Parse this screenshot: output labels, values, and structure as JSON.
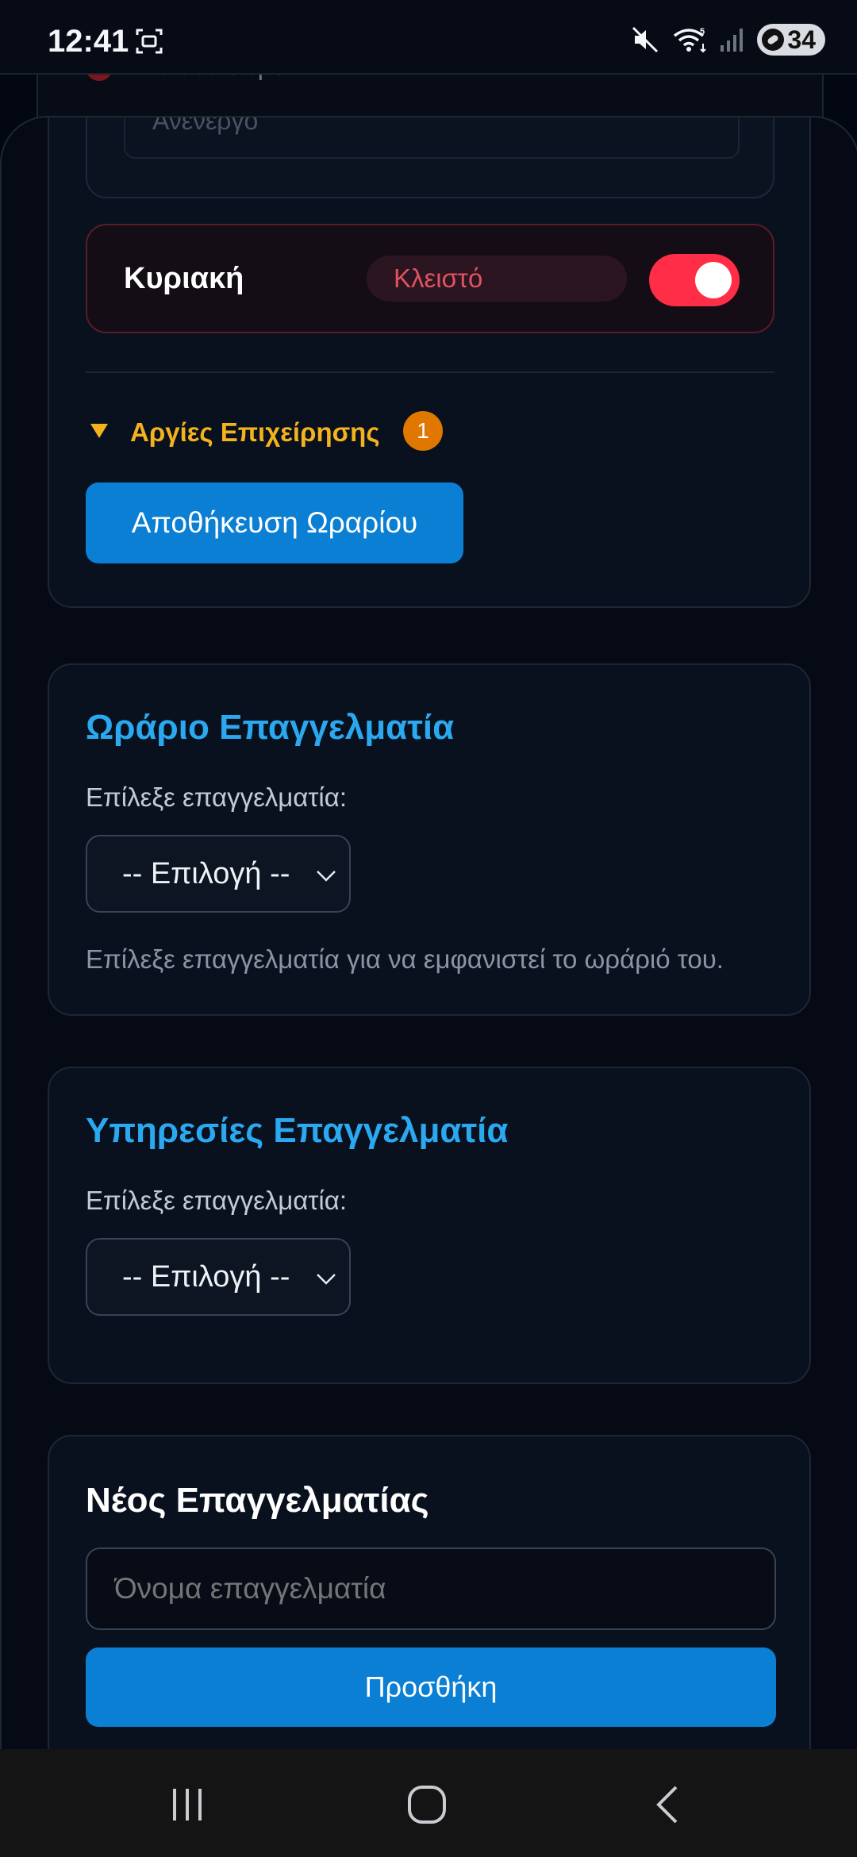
{
  "status_bar": {
    "time": "12:41",
    "battery": "34",
    "icons": [
      "screenshot-icon",
      "mute-icon",
      "wifi-icon",
      "signal-icon",
      "battery-icon"
    ]
  },
  "background_card": {
    "partial_text": "Κλειστό τώρα"
  },
  "schedule": {
    "disabled_field_text": "Ανενεργό",
    "sunday": {
      "day_label": "Κυριακή",
      "status": "Κλειστό",
      "toggle_on": true
    },
    "holidays": {
      "label": "Αργίες Επιχείρησης",
      "count": "1"
    },
    "save_button": "Αποθήκευση Ωραρίου"
  },
  "professional_schedule": {
    "title": "Ωράριο Επαγγελματία",
    "select_label": "Επίλεξε επαγγελματία:",
    "select_value": "-- Επιλογή --",
    "help_text": "Επίλεξε επαγγελματία για να εμφανιστεί το ωράριό του."
  },
  "professional_services": {
    "title": "Υπηρεσίες Επαγγελματία",
    "select_label": "Επίλεξε επαγγελματία:",
    "select_value": "-- Επιλογή --"
  },
  "new_professional": {
    "title": "Νέος Επαγγελματίας",
    "name_placeholder": "Όνομα επαγγελματία",
    "add_button": "Προσθήκη"
  },
  "colors": {
    "accent_blue": "#2aa8f0",
    "button_blue": "#0a7fd3",
    "toggle_red": "#ff2d46",
    "holiday_orange": "#f4b21c",
    "badge_orange": "#e07800",
    "closed_text": "#e0525f"
  }
}
